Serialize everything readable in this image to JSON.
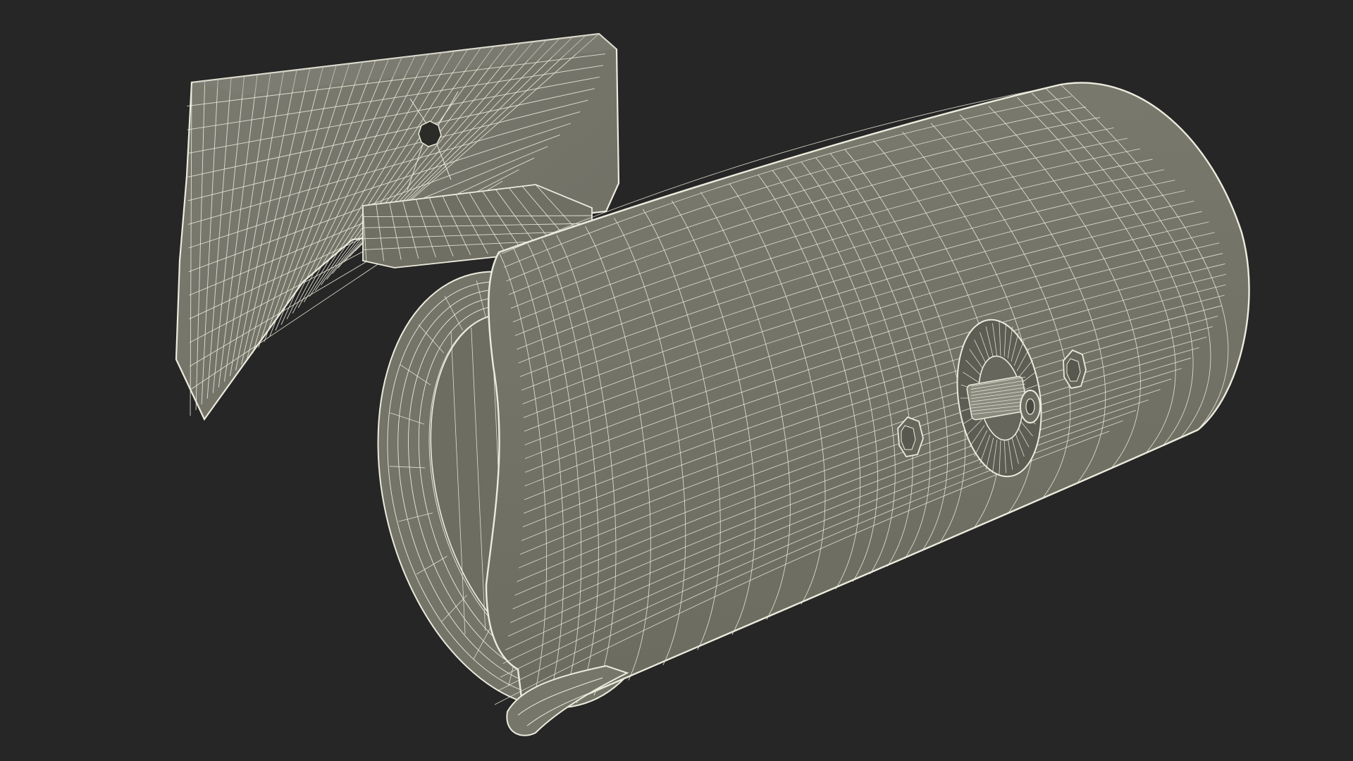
{
  "scene": {
    "background_color": "#262626",
    "surface_color": "#76766a",
    "surface_shade_color": "#6a6a60",
    "wire_color": "#ecebdd",
    "subject": "wireframe-3d-model"
  }
}
